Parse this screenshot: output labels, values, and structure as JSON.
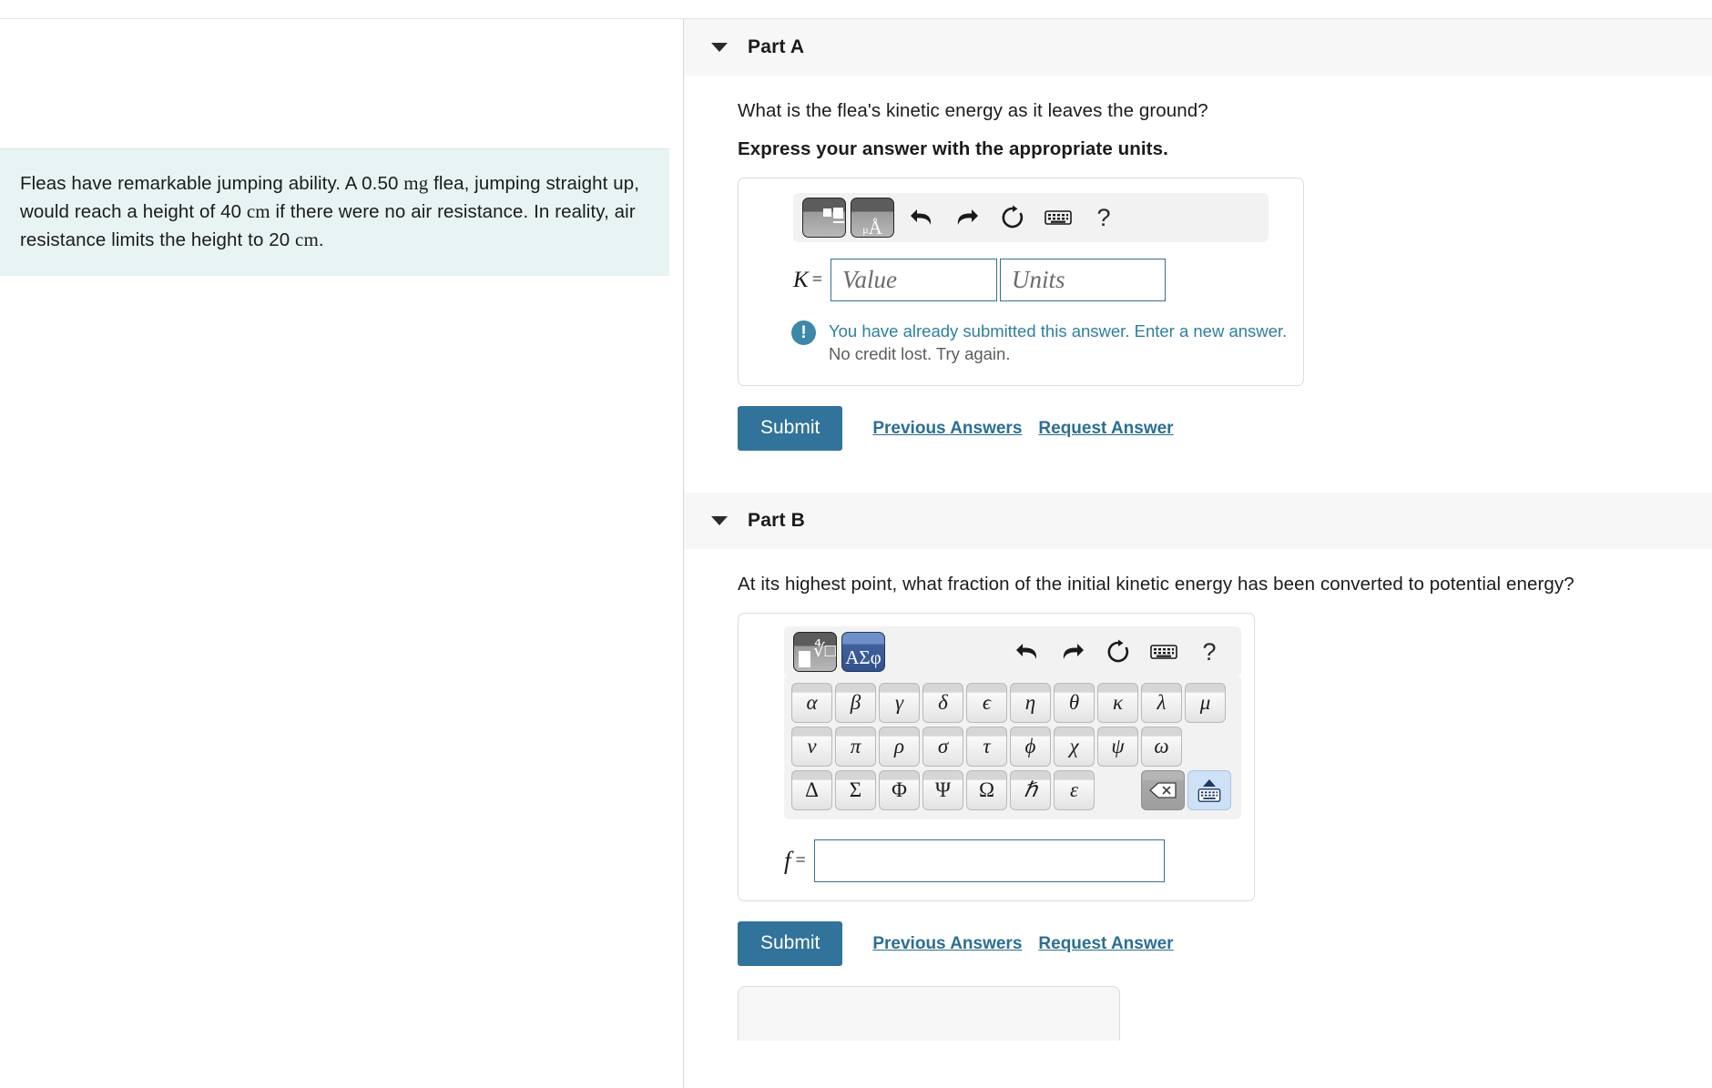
{
  "problem": {
    "statement_segments": [
      {
        "t": "Fleas have remarkable jumping ability. A 0.50 ",
        "s": "plain"
      },
      {
        "t": "mg",
        "s": "unit"
      },
      {
        "t": " flea, jumping straight up, would reach a height of 40 ",
        "s": "plain"
      },
      {
        "t": "cm",
        "s": "unit"
      },
      {
        "t": " if there were no air resistance. In reality, air resistance limits the height to 20 ",
        "s": "plain"
      },
      {
        "t": "cm",
        "s": "unit"
      },
      {
        "t": ".",
        "s": "plain"
      }
    ],
    "statement_text": "Fleas have remarkable jumping ability. A 0.50 mg flea, jumping straight up, would reach a height of 40 cm if there were no air resistance. In reality, air resistance limits the height to 20 cm."
  },
  "colors": {
    "accent": "#31739a",
    "link": "#2c6e92",
    "feedback_blue": "#2e7fa0",
    "feedback_gray": "#5d5d5d",
    "problem_bg": "#e8f4f4",
    "header_bg": "#f7f7f7",
    "input_border": "#36718f",
    "keypad_active": "#40619e"
  },
  "part_a": {
    "title": "Part A",
    "caret_icon": "caret-down-icon",
    "question": "What is the flea's kinetic energy as it leaves the ground?",
    "instruction": "Express your answer with the appropriate units.",
    "toolbar": {
      "palette_template_label": "template-palette",
      "palette_units_label": "μÅ",
      "units_mu": "μ",
      "units_a": "Å",
      "icons": [
        "undo-icon",
        "redo-icon",
        "reset-icon",
        "keyboard-icon",
        "help-icon"
      ],
      "help_label": "?"
    },
    "variable_label": "K",
    "equals": "=",
    "value_placeholder": "Value",
    "units_placeholder": "Units",
    "value_current": "",
    "units_current": "",
    "feedback": {
      "icon": "exclamation-circle-icon",
      "line1": "You have already submitted this answer. Enter a new answer.",
      "line2": "No credit lost. Try again."
    },
    "submit_label": "Submit",
    "previous_answers_label": "Previous Answers",
    "request_answer_label": "Request Answer"
  },
  "part_b": {
    "title": "Part B",
    "caret_icon": "caret-down-icon",
    "question": "At its highest point, what fraction of the initial kinetic energy has been converted to potential energy?",
    "toolbar": {
      "palette_template_label": "template-palette",
      "palette_greek_label": "ΑΣφ",
      "greek_palette_active": true,
      "icons": [
        "undo-icon",
        "redo-icon",
        "reset-icon",
        "keyboard-icon",
        "help-icon"
      ],
      "help_label": "?"
    },
    "keypad": {
      "row1": [
        "α",
        "β",
        "γ",
        "δ",
        "ϵ",
        "η",
        "θ",
        "κ",
        "λ",
        "μ"
      ],
      "row2": [
        "ν",
        "π",
        "ρ",
        "σ",
        "τ",
        "ϕ",
        "χ",
        "ψ",
        "ω"
      ],
      "row3": [
        "Δ",
        "Σ",
        "Φ",
        "Ψ",
        "Ω",
        "ℏ",
        "ε"
      ],
      "backspace_icon": "backspace-icon",
      "hide_keyboard_icon": "hide-keyboard-icon"
    },
    "variable_label": "f",
    "equals": "=",
    "answer_current": "",
    "submit_label": "Submit",
    "previous_answers_label": "Previous Answers",
    "request_answer_label": "Request Answer"
  }
}
